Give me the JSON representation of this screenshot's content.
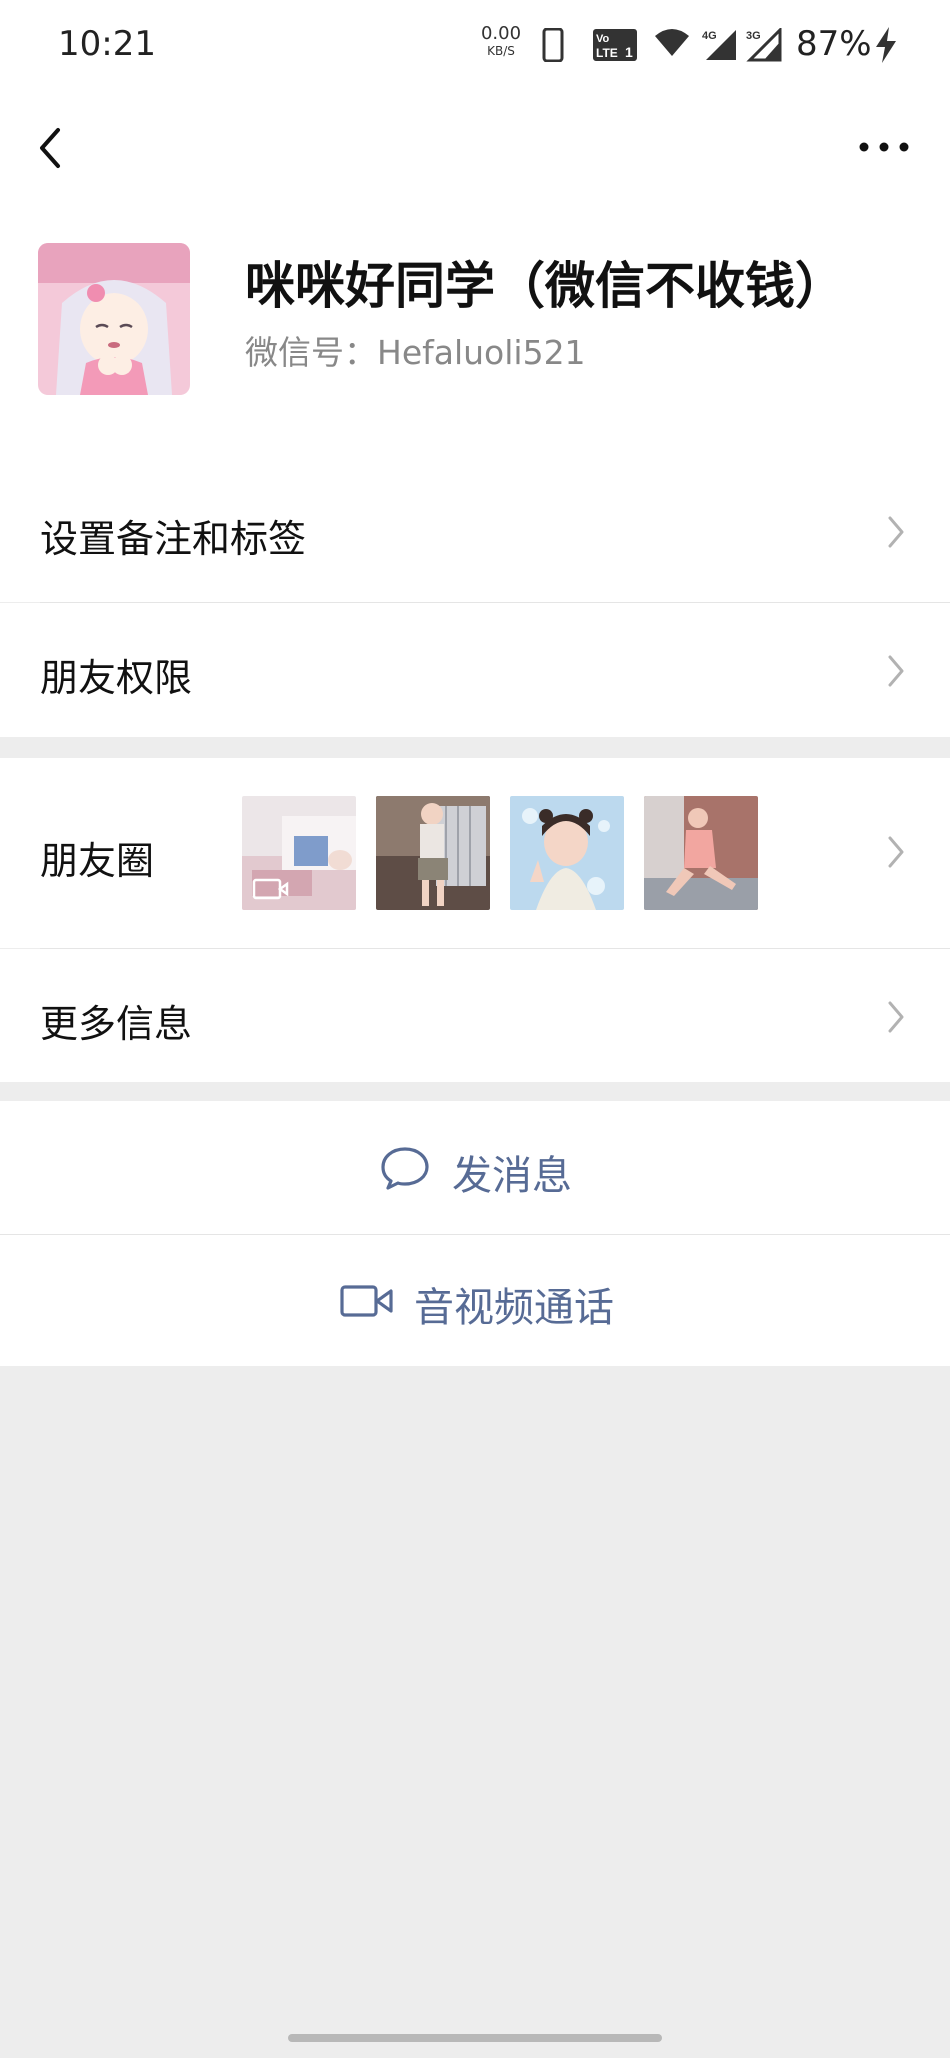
{
  "status_bar": {
    "time": "10:21",
    "net_speed": "0.00",
    "net_unit": "KB/S",
    "volte": "Vo LTE 1",
    "signal_4g": "4G",
    "signal_3g": "3G",
    "battery": "87%"
  },
  "header": {
    "back_icon": "chevron-left-icon",
    "more_icon": "more-horizontal-icon",
    "nickname": "咪咪好同学（微信不收钱）",
    "wechat_id": "微信号：Hefaluoli521"
  },
  "menu": {
    "remark_tags": "设置备注和标签",
    "friend_permissions": "朋友权限",
    "moments": "朋友圈",
    "more_info": "更多信息"
  },
  "actions": {
    "send_message": "发消息",
    "call": "音视频通话"
  },
  "colors": {
    "link_blue": "#576b95",
    "background": "#ededed"
  }
}
